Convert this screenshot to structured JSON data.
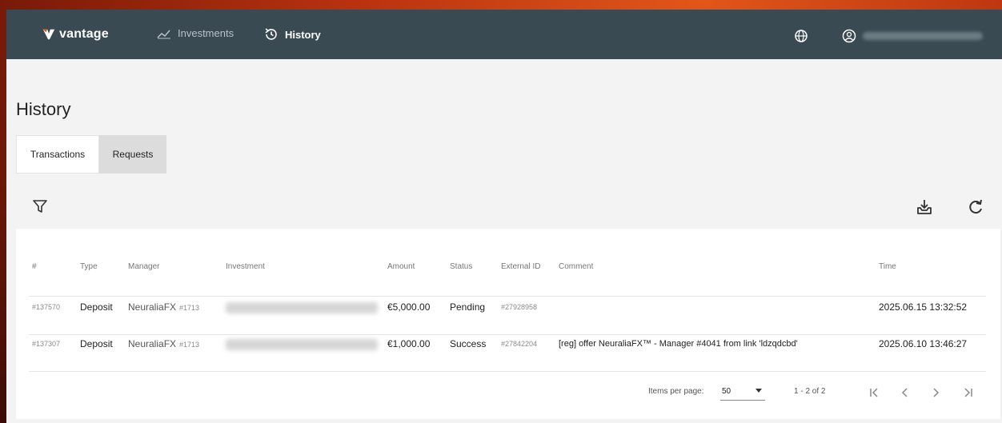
{
  "brand": {
    "name": "vantage"
  },
  "nav": {
    "investments": "Investments",
    "history": "History"
  },
  "page": {
    "title": "History"
  },
  "tabs": [
    {
      "label": "Transactions",
      "active": true
    },
    {
      "label": "Requests",
      "active": false
    }
  ],
  "table": {
    "headers": {
      "id": "#",
      "type": "Type",
      "manager": "Manager",
      "investment": "Investment",
      "amount": "Amount",
      "status": "Status",
      "external_id": "External ID",
      "comment": "Comment",
      "time": "Time"
    },
    "rows": [
      {
        "id": "#137570",
        "type": "Deposit",
        "manager": "NeuraliaFX",
        "manager_id": "#1713",
        "amount": "€5,000.00",
        "status": "Pending",
        "external_id": "#27928958",
        "comment": "",
        "time": "2025.06.15 13:32:52"
      },
      {
        "id": "#137307",
        "type": "Deposit",
        "manager": "NeuraliaFX",
        "manager_id": "#1713",
        "amount": "€1,000.00",
        "status": "Success",
        "external_id": "#27842204",
        "comment": "[reg] offer  NeuraliaFX™ - Manager #4041 from link 'ldzqdcbd'",
        "time": "2025.06.10 13:46:27"
      }
    ]
  },
  "pager": {
    "items_per_page_label": "Items per page:",
    "items_per_page": "50",
    "range": "1 - 2 of 2"
  },
  "colors": {
    "topbar": "#3a4a52",
    "page_bg": "#f3f3f3"
  }
}
